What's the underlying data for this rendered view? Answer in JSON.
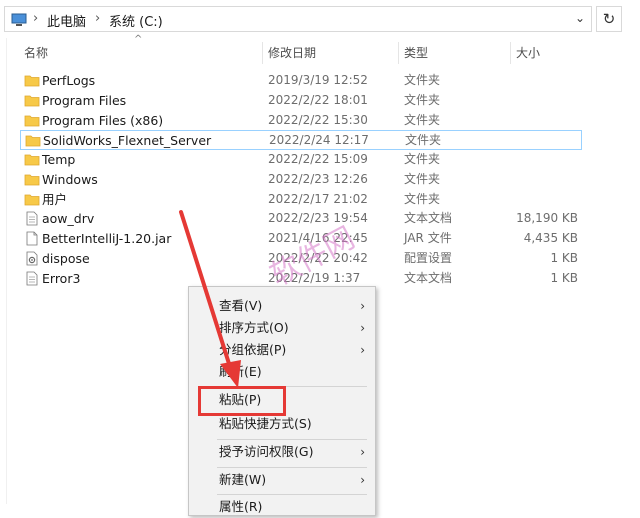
{
  "address_bar": {
    "crumbs": [
      "此电脑",
      "系统 (C:)"
    ],
    "separator": "›",
    "dropdown_glyph": "⌄",
    "pc_icon": "computer-icon"
  },
  "refresh_glyph": "↻",
  "columns": {
    "name": "名称",
    "date": "修改日期",
    "type": "类型",
    "size": "大小",
    "sort_indicator": "^"
  },
  "files": [
    {
      "name": "PerfLogs",
      "date": "2019/3/19 12:52",
      "type": "文件夹",
      "size": "",
      "icon": "folder-icon"
    },
    {
      "name": "Program Files",
      "date": "2022/2/22 18:01",
      "type": "文件夹",
      "size": "",
      "icon": "folder-icon"
    },
    {
      "name": "Program Files (x86)",
      "date": "2022/2/22 15:30",
      "type": "文件夹",
      "size": "",
      "icon": "folder-icon"
    },
    {
      "name": "SolidWorks_Flexnet_Server",
      "date": "2022/2/24 12:17",
      "type": "文件夹",
      "size": "",
      "icon": "folder-icon",
      "selected": true
    },
    {
      "name": "Temp",
      "date": "2022/2/22 15:09",
      "type": "文件夹",
      "size": "",
      "icon": "folder-icon"
    },
    {
      "name": "Windows",
      "date": "2022/2/23 12:26",
      "type": "文件夹",
      "size": "",
      "icon": "folder-icon"
    },
    {
      "name": "用户",
      "date": "2022/2/17 21:02",
      "type": "文件夹",
      "size": "",
      "icon": "folder-icon"
    },
    {
      "name": "aow_drv",
      "date": "2022/2/23 19:54",
      "type": "文本文档",
      "size": "18,190 KB",
      "icon": "text-file-icon"
    },
    {
      "name": "BetterIntelliJ-1.20.jar",
      "date": "2021/4/16 22:45",
      "type": "JAR 文件",
      "size": "4,435 KB",
      "icon": "jar-file-icon"
    },
    {
      "name": "dispose",
      "date": "2022/2/22 20:42",
      "type": "配置设置",
      "size": "1 KB",
      "icon": "config-file-icon"
    },
    {
      "name": "Error3",
      "date": "2022/2/19 1:37",
      "type": "文本文档",
      "size": "1 KB",
      "icon": "text-file-icon"
    }
  ],
  "context_menu": {
    "items": [
      {
        "label": "查看(V)",
        "has_submenu": true
      },
      {
        "label": "排序方式(O)",
        "has_submenu": true
      },
      {
        "label": "分组依据(P)",
        "has_submenu": true
      },
      {
        "label": "刷新(E)",
        "has_submenu": false
      },
      {
        "label": "粘贴(P)",
        "has_submenu": false,
        "highlighted": true
      },
      {
        "label": "粘贴快捷方式(S)",
        "has_submenu": false
      },
      {
        "label": "授予访问权限(G)",
        "has_submenu": true
      },
      {
        "label": "新建(W)",
        "has_submenu": true
      },
      {
        "label": "属性(R)",
        "has_submenu": false
      }
    ],
    "submenu_glyph": "›"
  },
  "annotation": {
    "watermark": "软件网",
    "arrow_color": "#e53935",
    "highlight_color": "#e53935"
  },
  "colors": {
    "folder": "#f7c948",
    "folder_dark": "#e0a82e",
    "selection_border": "#99d1ff",
    "menu_bg": "#f2f2f2"
  }
}
